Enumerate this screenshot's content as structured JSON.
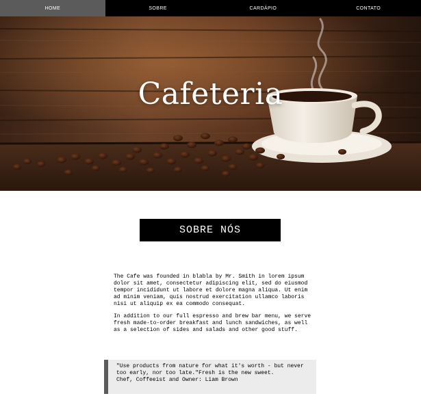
{
  "nav": {
    "items": [
      {
        "label": "HOME",
        "active": true
      },
      {
        "label": "SOBRE",
        "active": false
      },
      {
        "label": "CARDÁPIO",
        "active": false
      },
      {
        "label": "CONTATO",
        "active": false
      }
    ]
  },
  "hero": {
    "title": "Cafeteria"
  },
  "about": {
    "heading": "SOBRE NÓS",
    "paragraphs": [
      "The Cafe was founded in blabla by Mr. Smith in lorem ipsum dolor sit amet, consectetur adipiscing elit, sed do eiusmod tempor incididunt ut labore et dolore magna aliqua. Ut enim ad minim veniam, quis nostrud exercitation ullamco laboris nisi ut aliquip ex ea commodo consequat.",
      "In addition to our full espresso and brew bar menu, we serve fresh made-to-order breakfast and lunch sandwiches, as well as a selection of sides and salads and other good stuff."
    ]
  },
  "quote": {
    "text": "\"Use products from nature for what it's worth - but never too early, nor too late.\"Fresh is the new sweet.",
    "author": "Chef, Coffeeist and Owner: Liam Brown"
  },
  "colors": {
    "nav_bg": "#000000",
    "nav_active": "#5b5b5b",
    "heading_bg": "#000000",
    "quote_bg": "#ececec",
    "quote_border": "#5b5b5b"
  }
}
